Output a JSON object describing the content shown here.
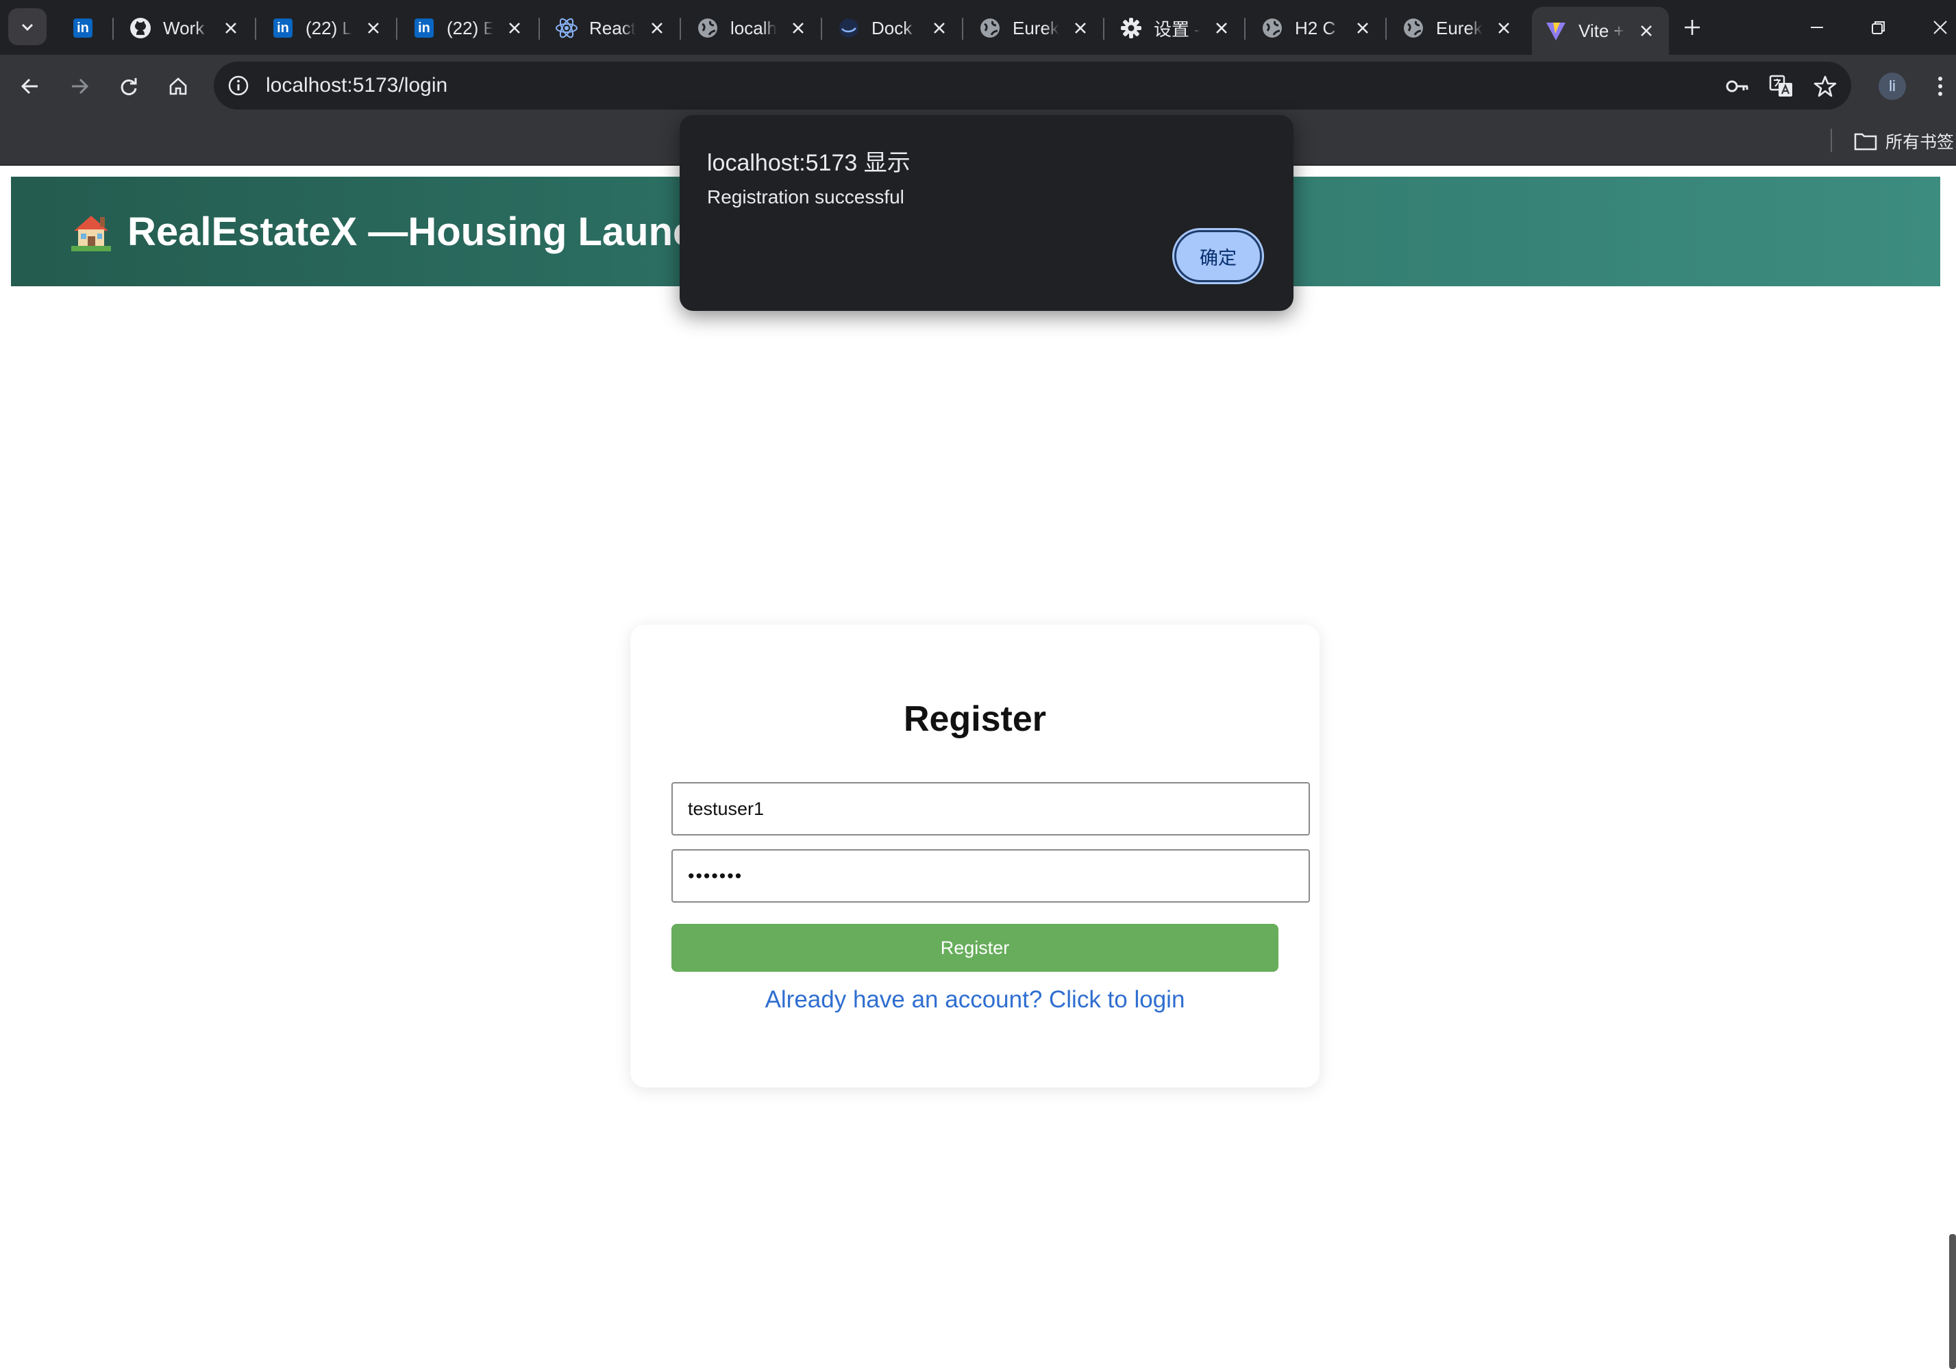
{
  "browser": {
    "tabs": [
      {
        "title": "",
        "icon": "linkedin-icon"
      },
      {
        "title": "Work",
        "icon": "github-icon"
      },
      {
        "title": "(22) L",
        "icon": "linkedin-icon"
      },
      {
        "title": "(22) E",
        "icon": "linkedin-icon"
      },
      {
        "title": "React",
        "icon": "react-icon"
      },
      {
        "title": "localh",
        "icon": "globe-icon"
      },
      {
        "title": "Dock",
        "icon": "docker-icon"
      },
      {
        "title": "Eurek",
        "icon": "globe-icon"
      },
      {
        "title": "设置 -",
        "icon": "gear-icon"
      },
      {
        "title": "H2 C",
        "icon": "globe-icon"
      },
      {
        "title": "Eurek",
        "icon": "globe-icon"
      },
      {
        "title": "Vite +",
        "icon": "vite-icon"
      }
    ],
    "url": "localhost:5173/login",
    "profile_initial": "li",
    "bookmarks_all": "所有书签"
  },
  "page": {
    "header_title": "RealEstateX —Housing Launch",
    "register_heading": "Register",
    "username_value": "testuser1",
    "password_value": "•••••••",
    "register_button": "Register",
    "login_link": "Already have an account? Click to login"
  },
  "alert": {
    "title": "localhost:5173 显示",
    "message": "Registration successful",
    "ok_label": "确定"
  },
  "colors": {
    "header_start": "#245c4f",
    "header_end": "#3d8c80",
    "register_button": "#67ad5b",
    "link": "#2f6ed0",
    "alert_button": "#a8c7fa"
  }
}
